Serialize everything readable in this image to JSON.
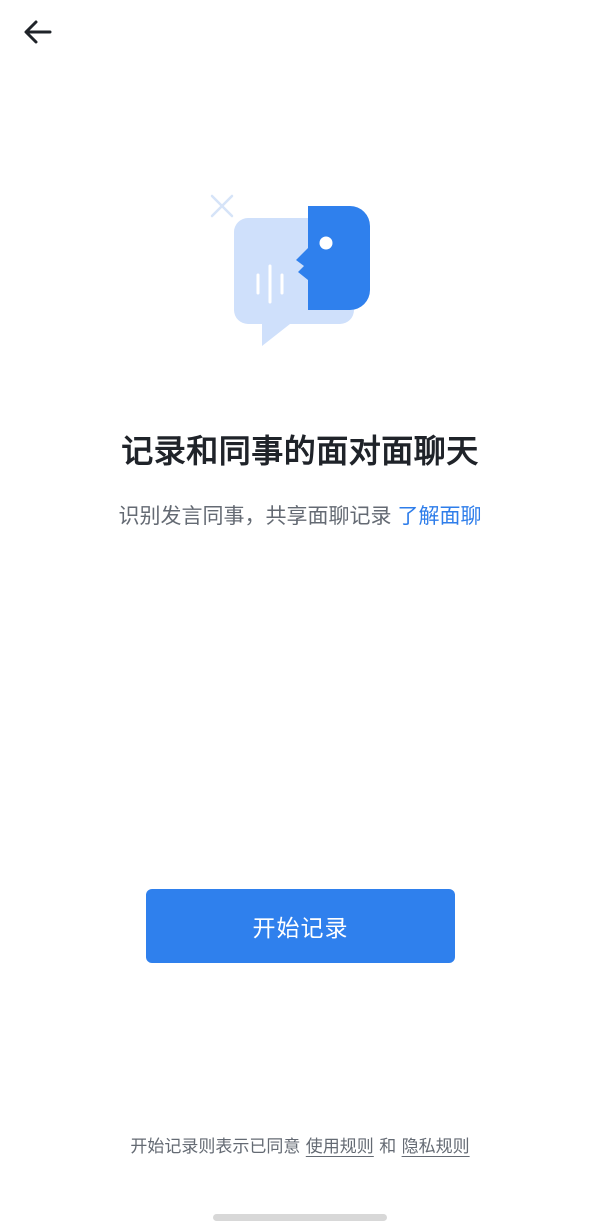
{
  "nav": {
    "back_icon": "arrow-left-icon"
  },
  "hero": {
    "icon": "face-to-face-chat-icon",
    "colors": {
      "bubble": "#cfe0fb",
      "head": "#2f80ed",
      "sparkle": "#d6e4f8"
    }
  },
  "main": {
    "title": "记录和同事的面对面聊天",
    "subtitle": "识别发言同事，共享面聊记录",
    "learn_more": "了解面聊"
  },
  "actions": {
    "start_label": "开始记录",
    "accent": "#2f80ed"
  },
  "footer": {
    "prefix": "开始记录则表示已同意",
    "terms_label": "使用规则",
    "conjunction": "和",
    "privacy_label": "隐私规则"
  }
}
